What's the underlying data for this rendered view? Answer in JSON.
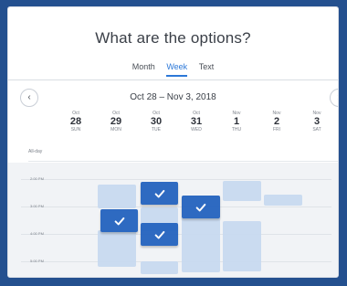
{
  "title": "What are the options?",
  "tabs": {
    "month": "Month",
    "week": "Week",
    "text": "Text"
  },
  "nav": {
    "range": "Oct 28 – Nov 3, 2018"
  },
  "days": [
    {
      "month": "Oct",
      "date": "28",
      "weekday": "SUN"
    },
    {
      "month": "Oct",
      "date": "29",
      "weekday": "MON"
    },
    {
      "month": "Oct",
      "date": "30",
      "weekday": "TUE"
    },
    {
      "month": "Oct",
      "date": "31",
      "weekday": "WED"
    },
    {
      "month": "Nov",
      "date": "1",
      "weekday": "THU"
    },
    {
      "month": "Nov",
      "date": "2",
      "weekday": "FRI"
    },
    {
      "month": "Nov",
      "date": "3",
      "weekday": "SAT"
    }
  ],
  "all_day_label": "All-day",
  "hours": [
    "2:00 PM",
    "3:00 PM",
    "4:00 PM",
    "5:00 PM"
  ],
  "colors": {
    "frame": "#24508f",
    "selected": "#2463bf",
    "slot": "#c7d9ef",
    "accent": "#2c78d8"
  },
  "icons": {
    "prev": "chevron-left-icon",
    "next": "chevron-right-icon",
    "check": "check-icon"
  }
}
